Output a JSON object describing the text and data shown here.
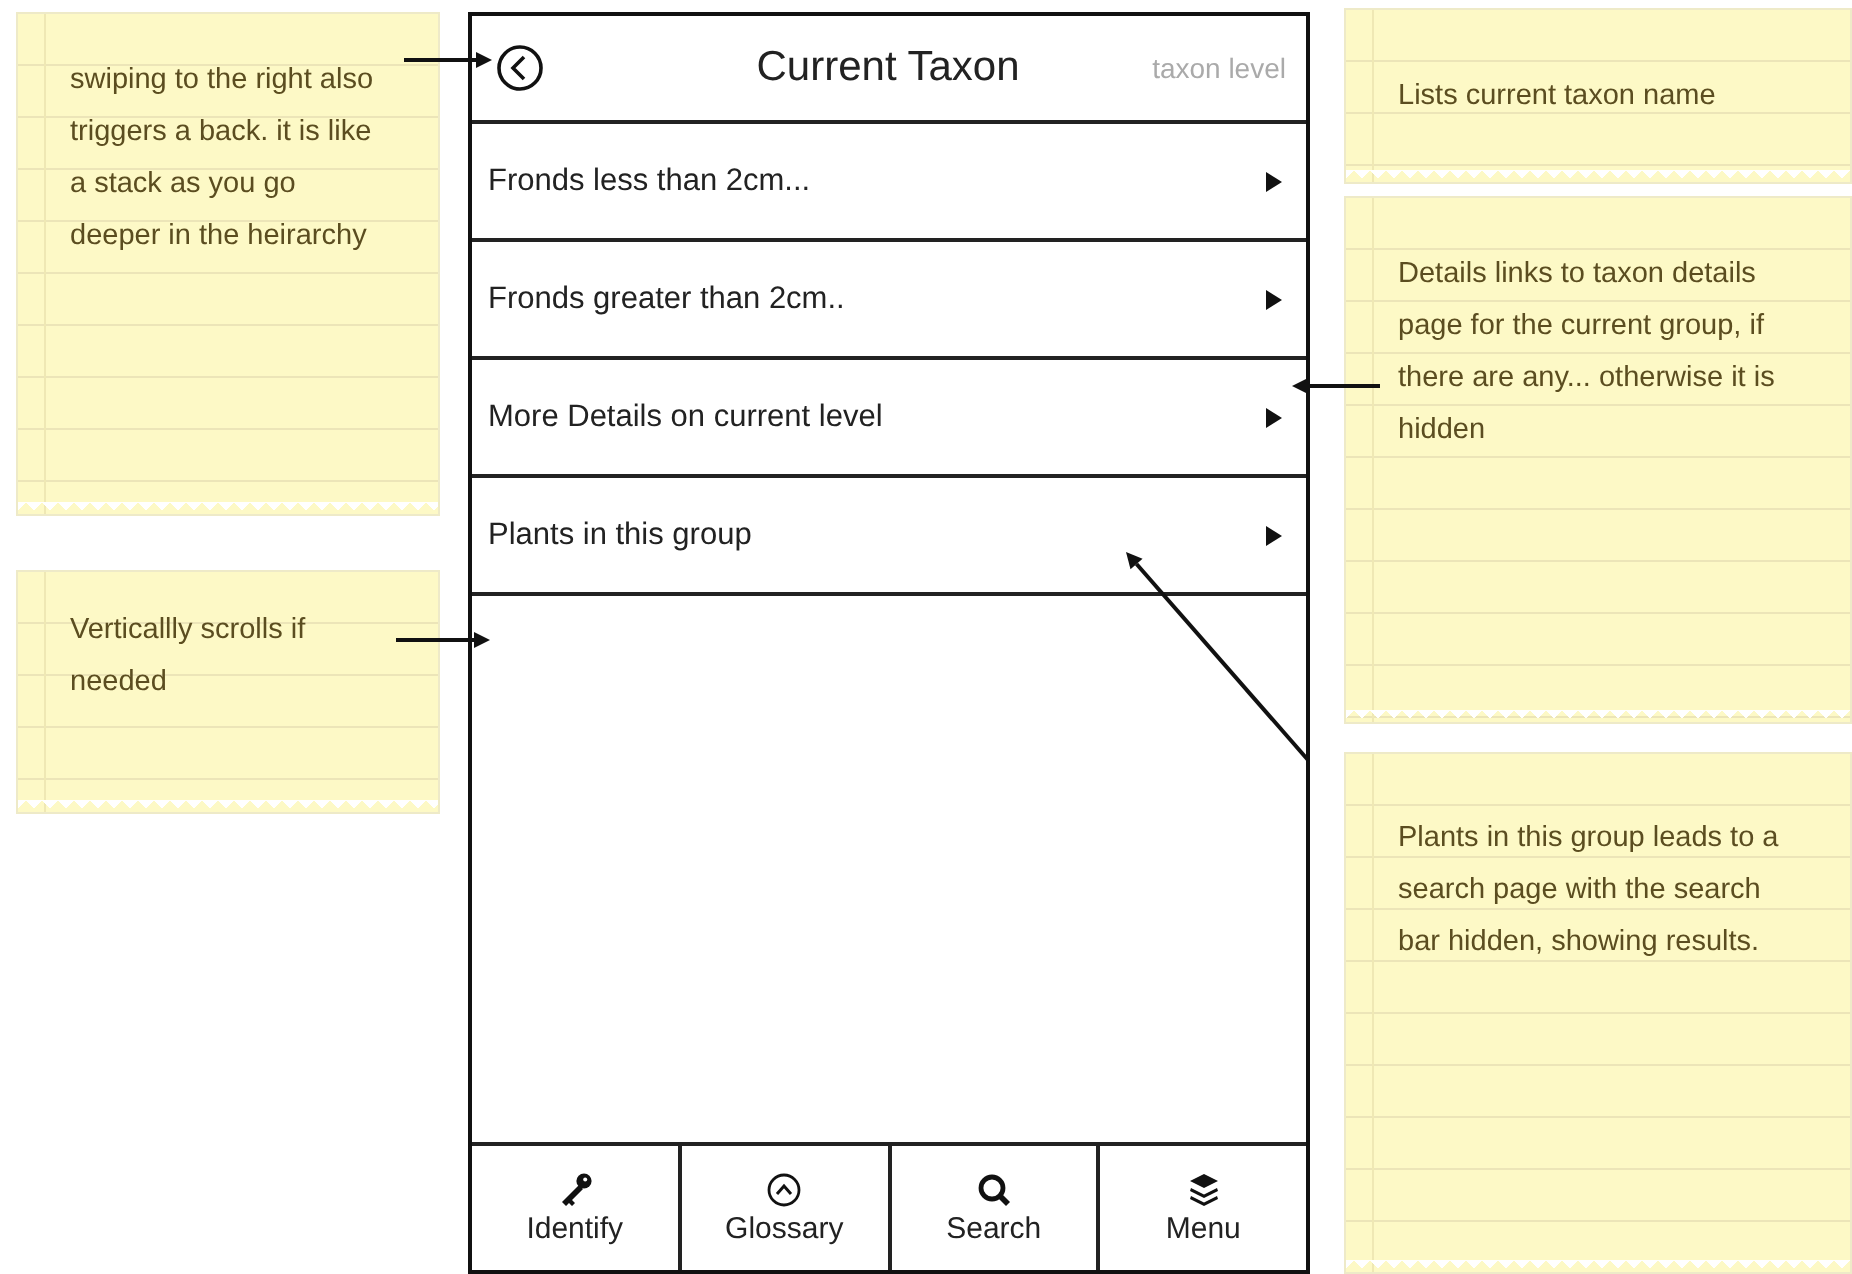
{
  "header": {
    "title": "Current Taxon",
    "level_label": "taxon level"
  },
  "rows": [
    {
      "label": "Fronds less than 2cm..."
    },
    {
      "label": "Fronds greater than 2cm.."
    },
    {
      "label": "More Details on current level"
    },
    {
      "label": "Plants in this group"
    }
  ],
  "tabs": [
    {
      "label": "Identify"
    },
    {
      "label": "Glossary"
    },
    {
      "label": "Search"
    },
    {
      "label": "Menu"
    }
  ],
  "notes": [
    {
      "text": "swiping to the right also triggers a back. it is like a stack as you go deeper in the heirarchy"
    },
    {
      "text": "Verticallly scrolls if needed"
    },
    {
      "text": "Lists current taxon name"
    },
    {
      "text": "Details links to taxon details page for the current group, if there are any... otherwise it is hidden"
    },
    {
      "text": "Plants in this group leads to a search page with the search bar hidden, showing results."
    }
  ]
}
